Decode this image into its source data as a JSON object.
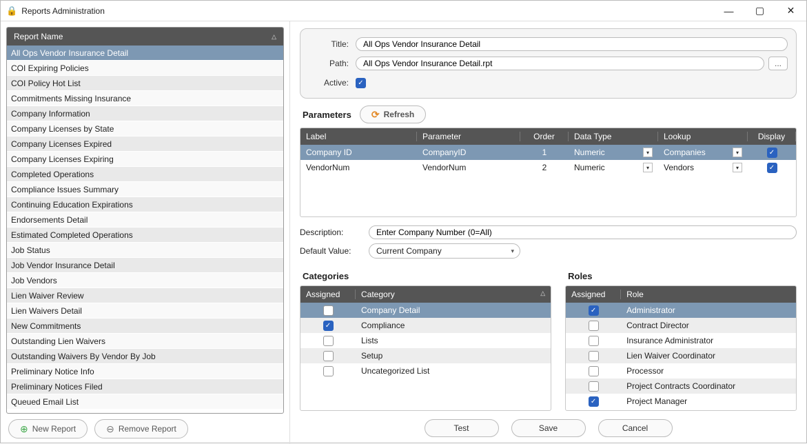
{
  "window": {
    "title": "Reports Administration"
  },
  "reports": {
    "header": "Report Name",
    "selected_index": 0,
    "items": [
      "All Ops Vendor Insurance Detail",
      "COI Expiring Policies",
      "COI Policy Hot List",
      "Commitments Missing Insurance",
      "Company Information",
      "Company Licenses by State",
      "Company Licenses Expired",
      "Company Licenses Expiring",
      "Completed Operations",
      "Compliance Issues Summary",
      "Continuing Education Expirations",
      "Endorsements Detail",
      "Estimated Completed Operations",
      "Job Status",
      "Job Vendor Insurance Detail",
      "Job Vendors",
      "Lien Waiver Review",
      "Lien Waivers Detail",
      "New Commitments",
      "Outstanding Lien Waivers",
      "Outstanding Waivers By Vendor By Job",
      "Preliminary Notice Info",
      "Preliminary Notices Filed",
      "Queued Email List"
    ],
    "new_label": "New Report",
    "remove_label": "Remove Report"
  },
  "detail": {
    "title_label": "Title:",
    "title_value": "All Ops Vendor Insurance Detail",
    "path_label": "Path:",
    "path_value": "All Ops Vendor Insurance Detail.rpt",
    "path_browse": "...",
    "active_label": "Active:",
    "active_checked": true
  },
  "parameters": {
    "section_title": "Parameters",
    "refresh_label": "Refresh",
    "headers": {
      "label": "Label",
      "parameter": "Parameter",
      "order": "Order",
      "datatype": "Data Type",
      "lookup": "Lookup",
      "display": "Display"
    },
    "rows": [
      {
        "label": "Company ID",
        "parameter": "CompanyID",
        "order": "1",
        "datatype": "Numeric",
        "lookup": "Companies",
        "display": true,
        "selected": true
      },
      {
        "label": "VendorNum",
        "parameter": "VendorNum",
        "order": "2",
        "datatype": "Numeric",
        "lookup": "Vendors",
        "display": true,
        "selected": false
      }
    ],
    "description_label": "Description:",
    "description_value": "Enter Company Number (0=All)",
    "default_value_label": "Default Value:",
    "default_value": "Current Company"
  },
  "categories": {
    "section_title": "Categories",
    "headers": {
      "assigned": "Assigned",
      "category": "Category"
    },
    "rows": [
      {
        "assigned": false,
        "label": "Company Detail",
        "selected": true
      },
      {
        "assigned": true,
        "label": "Compliance"
      },
      {
        "assigned": false,
        "label": "Lists"
      },
      {
        "assigned": false,
        "label": "Setup"
      },
      {
        "assigned": false,
        "label": "Uncategorized List"
      }
    ]
  },
  "roles": {
    "section_title": "Roles",
    "headers": {
      "assigned": "Assigned",
      "role": "Role"
    },
    "rows": [
      {
        "assigned": true,
        "label": "Administrator",
        "selected": true
      },
      {
        "assigned": false,
        "label": "Contract Director"
      },
      {
        "assigned": false,
        "label": "Insurance Administrator"
      },
      {
        "assigned": false,
        "label": "Lien Waiver Coordinator"
      },
      {
        "assigned": false,
        "label": "Processor"
      },
      {
        "assigned": false,
        "label": "Project Contracts Coordinator"
      },
      {
        "assigned": true,
        "label": "Project Manager"
      }
    ]
  },
  "actions": {
    "test": "Test",
    "save": "Save",
    "cancel": "Cancel"
  }
}
